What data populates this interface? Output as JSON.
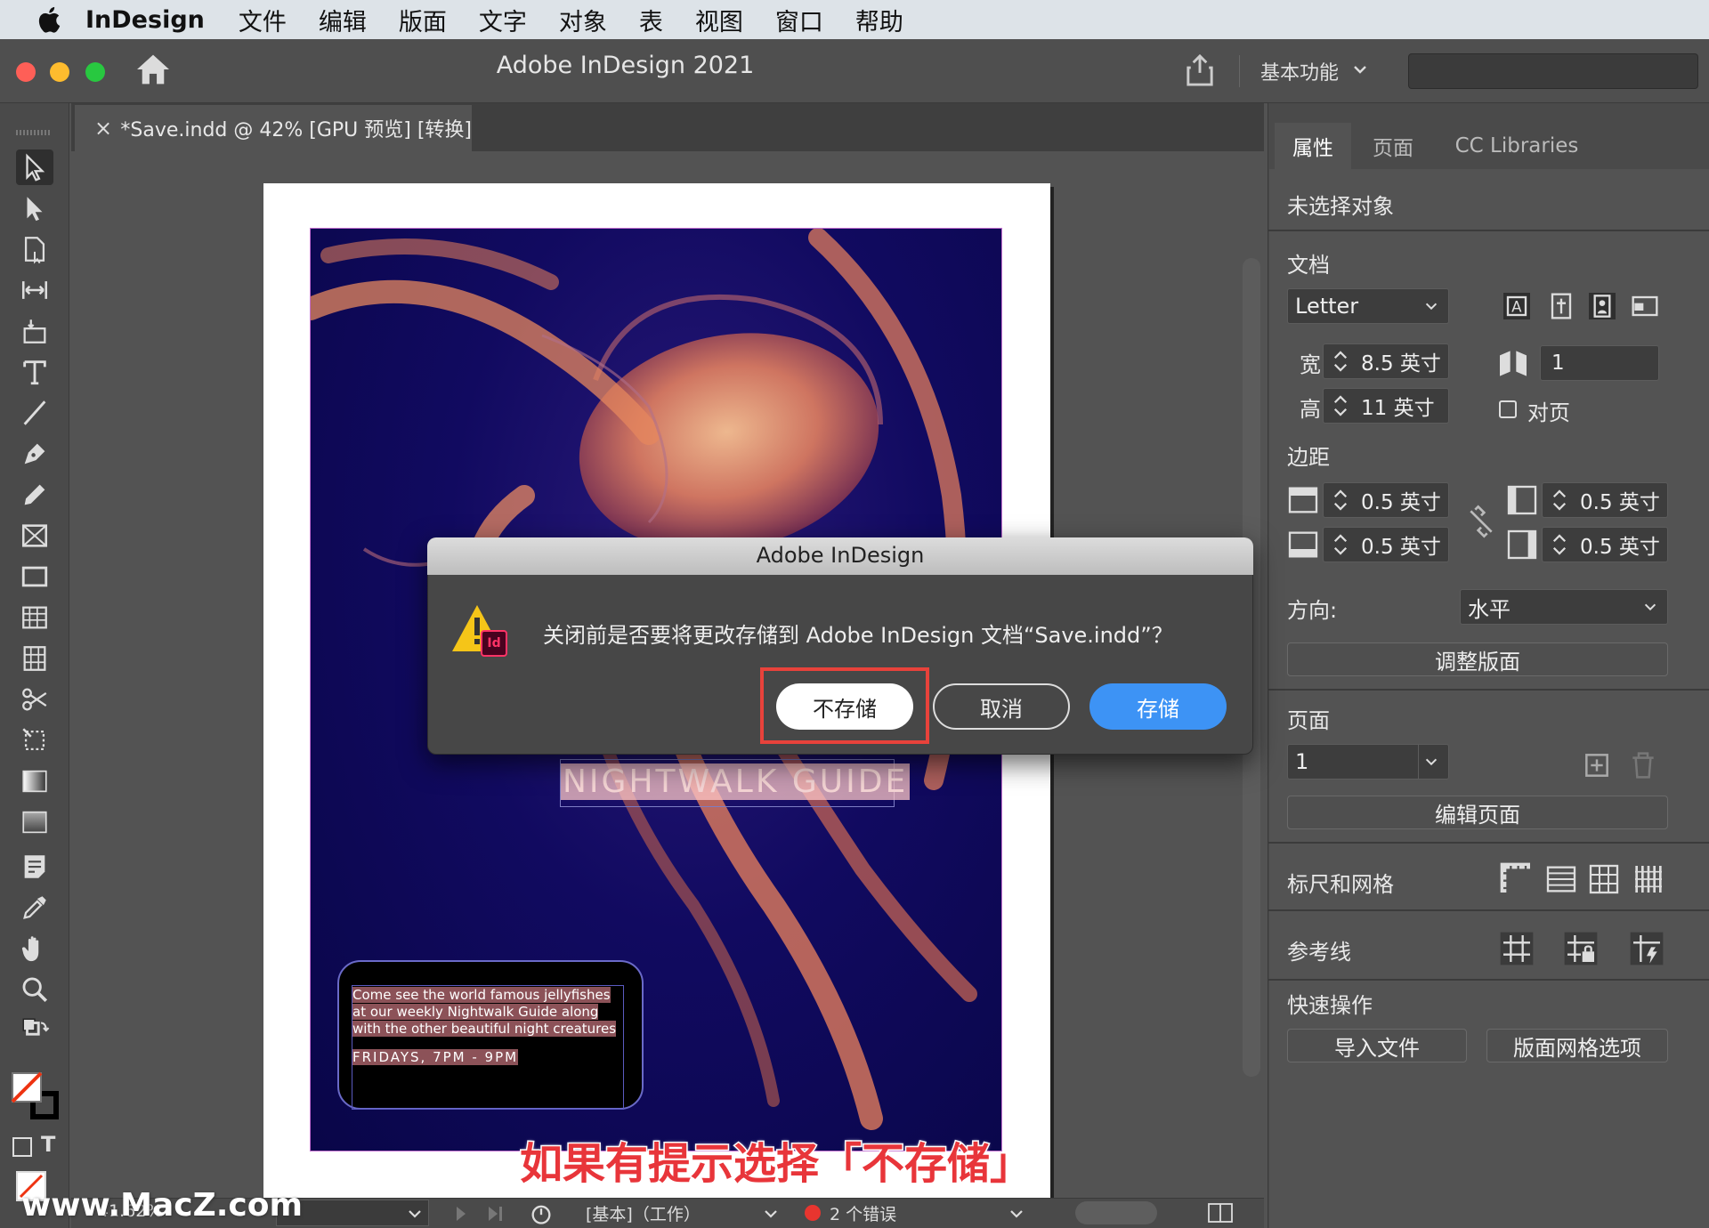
{
  "menubar": {
    "items": [
      "InDesign",
      "文件",
      "编辑",
      "版面",
      "文字",
      "对象",
      "表",
      "视图",
      "窗口",
      "帮助"
    ]
  },
  "titlebar": {
    "app_title": "Adobe InDesign 2021",
    "workspace": "基本功能"
  },
  "document_tab": {
    "close_glyph": "×",
    "label": "*Save.indd @ 42% [GPU 预览] [转换]"
  },
  "artwork": {
    "headline": "NIGHTWALK GUIDE",
    "body_lines": [
      "Come see the world famous jellyfishes",
      "at our weekly Nightwalk Guide along",
      "with the other beautiful night creatures"
    ],
    "schedule": "FRIDAYS, 7PM - 9PM"
  },
  "panel": {
    "tabs": [
      "属性",
      "页面",
      "CC Libraries"
    ],
    "no_selection": "未选择对象",
    "document": {
      "section": "文档",
      "page_size": "Letter",
      "width_label": "宽",
      "width": "8.5 英寸",
      "height_label": "高",
      "height": "11 英寸",
      "pages": "1",
      "facing_pages": "对页"
    },
    "margins": {
      "section": "边距",
      "top": "0.5 英寸",
      "bottom": "0.5 英寸",
      "left": "0.5 英寸",
      "right": "0.5 英寸"
    },
    "orientation_label": "方向:",
    "orientation": "水平",
    "adjust_layout": "调整版面",
    "page": {
      "section": "页面",
      "current": "1",
      "edit_page": "编辑页面"
    },
    "rulers_grids": "标尺和网格",
    "guides": "参考线",
    "quick_actions": {
      "section": "快速操作",
      "import_file": "导入文件",
      "layout_grid": "版面网格选项"
    }
  },
  "statusbar": {
    "zoom": "41.62%",
    "preflight_profile": "[基本]（工作）",
    "errors": "2 个错误"
  },
  "dialog": {
    "title": "Adobe InDesign",
    "message": "关闭前是否要将更改存储到 Adobe InDesign 文档“Save.indd”？",
    "dont_save": "不存储",
    "cancel": "取消",
    "save": "存储",
    "icon_badge": "Id"
  },
  "overlay": {
    "caption": "如果有提示选择「不存储」",
    "watermark": "www.MacZ.com"
  },
  "colors": {
    "accent": "#3d93f5",
    "highlight": "#e8423b",
    "close": "#fe5f57",
    "minimize": "#febc2e",
    "zoom": "#28c840"
  }
}
